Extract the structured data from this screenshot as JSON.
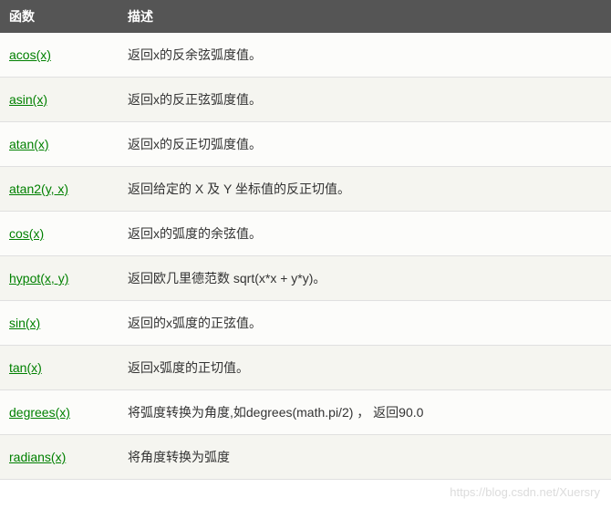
{
  "headers": {
    "col1": "函数",
    "col2": "描述"
  },
  "rows": [
    {
      "func": "acos(x)",
      "desc": "返回x的反余弦弧度值。"
    },
    {
      "func": "asin(x)",
      "desc": "返回x的反正弦弧度值。"
    },
    {
      "func": "atan(x)",
      "desc": "返回x的反正切弧度值。"
    },
    {
      "func": "atan2(y, x)",
      "desc": "返回给定的 X 及 Y 坐标值的反正切值。"
    },
    {
      "func": "cos(x)",
      "desc": "返回x的弧度的余弦值。"
    },
    {
      "func": "hypot(x, y)",
      "desc": "返回欧几里德范数 sqrt(x*x + y*y)。"
    },
    {
      "func": "sin(x)",
      "desc": "返回的x弧度的正弦值。"
    },
    {
      "func": "tan(x)",
      "desc": "返回x弧度的正切值。"
    },
    {
      "func": "degrees(x)",
      "desc": "将弧度转换为角度,如degrees(math.pi/2) ，  返回90.0"
    },
    {
      "func": "radians(x)",
      "desc": "将角度转换为弧度"
    }
  ],
  "watermark": "https://blog.csdn.net/Xuersry"
}
